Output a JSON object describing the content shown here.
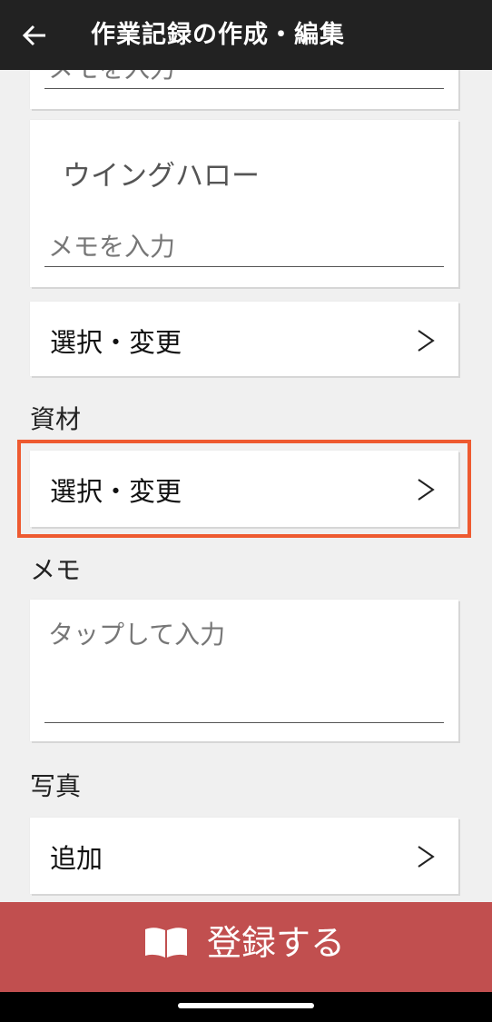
{
  "header": {
    "title": "作業記録の作成・編集"
  },
  "cards": {
    "top_memo_partial": {
      "placeholder": "メモを入力"
    },
    "item": {
      "name": "ウイングハロー",
      "memo_placeholder": "メモを入力"
    },
    "select_change_1": {
      "label": "選択・変更",
      "chevron": ">"
    }
  },
  "materials": {
    "section_label": "資材",
    "select_label": "選択・変更",
    "chevron": ">"
  },
  "memo": {
    "section_label": "メモ",
    "placeholder": "タップして入力"
  },
  "photos": {
    "section_label": "写真",
    "add_label": "追加",
    "chevron": ">"
  },
  "register_button": {
    "label": "登録する",
    "icon": "book-open-icon"
  },
  "colors": {
    "appbar": "#222222",
    "register_button": "#c14f4f",
    "highlight_outline": "#ee5a30",
    "background": "#f0f0f0"
  }
}
